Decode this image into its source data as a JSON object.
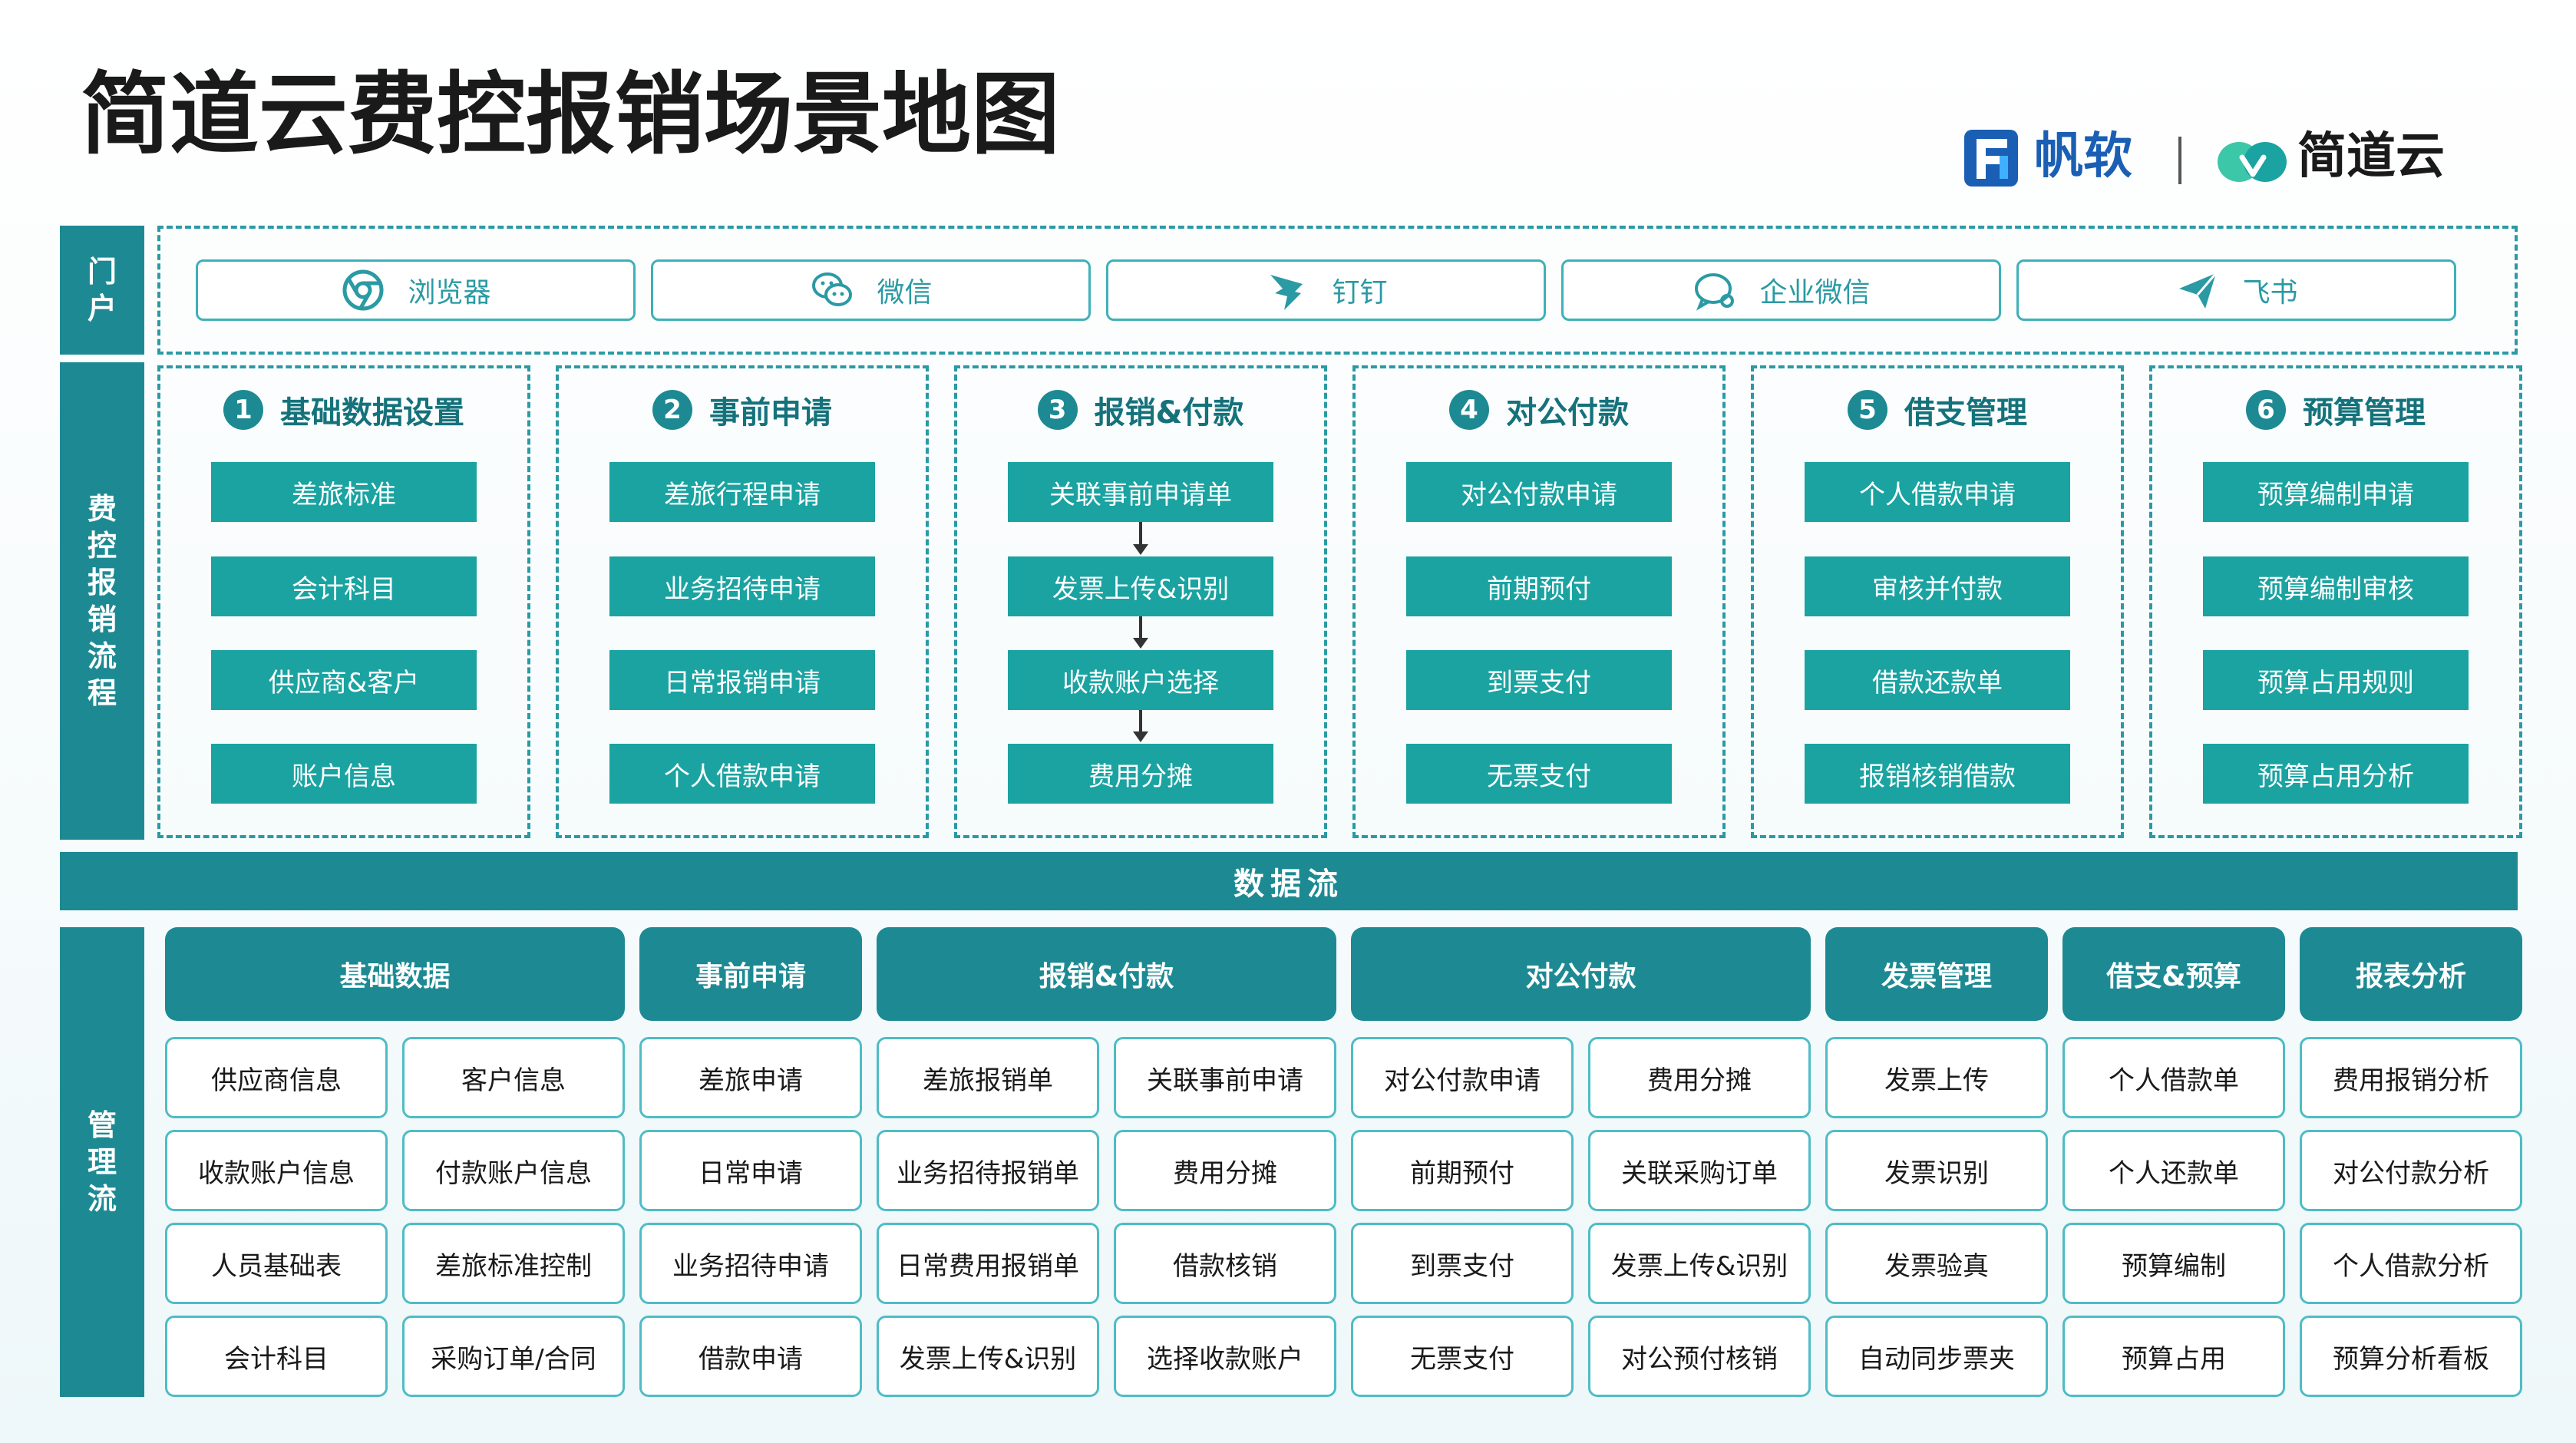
{
  "title": "简道云费控报销场景地图",
  "logos": {
    "fanruan": "帆软",
    "jiandaoyun": "简道云"
  },
  "side_labels": {
    "portal": "门户",
    "process": "费控报销流程",
    "manage": "管理流"
  },
  "portal_items": [
    {
      "label": "浏览器",
      "icon": "browser-icon"
    },
    {
      "label": "微信",
      "icon": "wechat-icon"
    },
    {
      "label": "钉钉",
      "icon": "dingtalk-icon"
    },
    {
      "label": "企业微信",
      "icon": "wecom-icon"
    },
    {
      "label": "飞书",
      "icon": "feishu-icon"
    }
  ],
  "sections": [
    {
      "num": "1",
      "title": "基础数据设置",
      "items": [
        "差旅标准",
        "会计科目",
        "供应商&客户",
        "账户信息"
      ]
    },
    {
      "num": "2",
      "title": "事前申请",
      "items": [
        "差旅行程申请",
        "业务招待申请",
        "日常报销申请",
        "个人借款申请"
      ]
    },
    {
      "num": "3",
      "title": "报销&付款",
      "items": [
        "关联事前申请单",
        "发票上传&识别",
        "收款账户选择",
        "费用分摊"
      ]
    },
    {
      "num": "4",
      "title": "对公付款",
      "items": [
        "对公付款申请",
        "前期预付",
        "到票支付",
        "无票支付"
      ]
    },
    {
      "num": "5",
      "title": "借支管理",
      "items": [
        "个人借款申请",
        "审核并付款",
        "借款还款单",
        "报销核销借款"
      ]
    },
    {
      "num": "6",
      "title": "预算管理",
      "items": [
        "预算编制申请",
        "预算编制审核",
        "预算占用规则",
        "预算占用分析"
      ]
    }
  ],
  "data_flow": "数据流",
  "manage_groups": [
    {
      "title": "基础数据",
      "columns": [
        [
          "供应商信息",
          "收款账户信息",
          "人员基础表",
          "会计科目"
        ],
        [
          "客户信息",
          "付款账户信息",
          "差旅标准控制",
          "采购订单/合同"
        ]
      ]
    },
    {
      "title": "事前申请",
      "columns": [
        [
          "差旅申请",
          "日常申请",
          "业务招待申请",
          "借款申请"
        ]
      ]
    },
    {
      "title": "报销&付款",
      "columns": [
        [
          "差旅报销单",
          "业务招待报销单",
          "日常费用报销单",
          "发票上传&识别"
        ],
        [
          "关联事前申请",
          "费用分摊",
          "借款核销",
          "选择收款账户"
        ]
      ]
    },
    {
      "title": "对公付款",
      "columns": [
        [
          "对公付款申请",
          "前期预付",
          "到票支付",
          "无票支付"
        ],
        [
          "费用分摊",
          "关联采购订单",
          "发票上传&识别",
          "对公预付核销"
        ]
      ]
    },
    {
      "title": "发票管理",
      "columns": [
        [
          "发票上传",
          "发票识别",
          "发票验真",
          "自动同步票夹"
        ]
      ]
    },
    {
      "title": "借支&预算",
      "columns": [
        [
          "个人借款单",
          "个人还款单",
          "预算编制",
          "预算占用"
        ]
      ]
    },
    {
      "title": "报表分析",
      "columns": [
        [
          "费用报销分析",
          "对公付款分析",
          "个人借款分析",
          "预算分析看板"
        ]
      ]
    }
  ],
  "colors": {
    "primary": "#1d8a93",
    "box": "#1aa3a1",
    "border": "#4fbcc5"
  }
}
